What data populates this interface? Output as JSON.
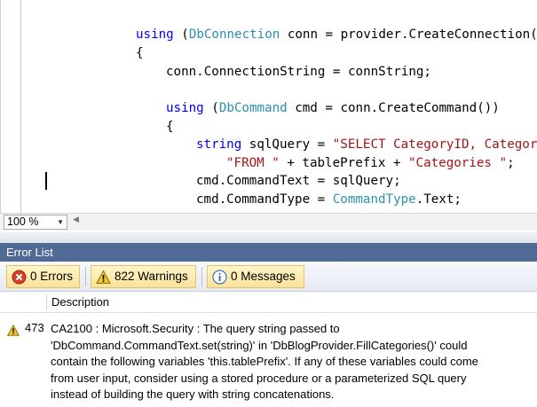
{
  "editor": {
    "lines": [
      [
        {
          "t": "using",
          "c": "kw"
        },
        {
          "t": " ("
        },
        {
          "t": "DbConnection",
          "c": "tp"
        },
        {
          "t": " conn = provider.CreateConnection("
        }
      ],
      [
        {
          "t": "{"
        }
      ],
      [
        {
          "t": "conn.ConnectionString = connString;"
        }
      ],
      [
        {
          "t": "using",
          "c": "kw"
        },
        {
          "t": " ("
        },
        {
          "t": "DbCommand",
          "c": "tp"
        },
        {
          "t": " cmd = conn.CreateCommand())"
        }
      ],
      [
        {
          "t": "{"
        }
      ],
      [
        {
          "t": "string",
          "c": "kw"
        },
        {
          "t": " sqlQuery = "
        },
        {
          "t": "\"SELECT CategoryID, Categor",
          "c": "str"
        }
      ],
      [
        {
          "t": "\"FROM \"",
          "c": "str"
        },
        {
          "t": " + tablePrefix + "
        },
        {
          "t": "\"Categories \"",
          "c": "str"
        },
        {
          "t": ";"
        }
      ],
      [
        {
          "t": "cmd.CommandText = sqlQuery;"
        }
      ],
      [
        {
          "t": "cmd.CommandType = "
        },
        {
          "t": "CommandType",
          "c": "tp"
        },
        {
          "t": ".Text;"
        }
      ]
    ]
  },
  "zoom": {
    "value": "100 %"
  },
  "error_list": {
    "title": "Error List",
    "filters": {
      "errors": "0 Errors",
      "warnings": "822 Warnings",
      "messages": "0 Messages"
    },
    "columns": {
      "description": "Description"
    },
    "rows": [
      {
        "number": "473",
        "severity_icon": "warning-icon",
        "description": "CA2100 : Microsoft.Security : The query string passed to\n'DbCommand.CommandText.set(string)' in 'DbBlogProvider.FillCategories()' could\ncontain the following variables 'this.tablePrefix'. If any of these variables could come\nfrom user input, consider using a stored procedure or a parameterized SQL query\ninstead of building the query with string concatenations."
      }
    ]
  },
  "colors": {
    "keyword": "#0000ff",
    "type": "#2b91af",
    "string": "#a31515",
    "panel_title_bg": "#4e6a95",
    "filter_button_bg": "#fbe29a"
  }
}
